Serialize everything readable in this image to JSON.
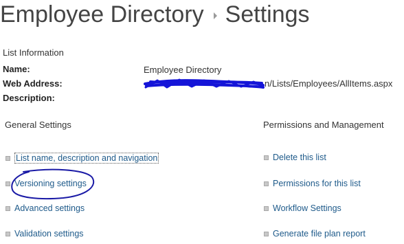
{
  "header": {
    "list_name": "Employee Directory",
    "page_name": "Settings"
  },
  "list_info": {
    "section_title": "List Information",
    "name_label": "Name:",
    "name_value": "Employee Directory",
    "web_address_label": "Web Address:",
    "web_address_suffix": "n/Lists/Employees/AllItems.aspx",
    "description_label": "Description:"
  },
  "general_settings": {
    "title": "General Settings",
    "items": [
      {
        "label": "List name, description and navigation"
      },
      {
        "label": "Versioning settings"
      },
      {
        "label": "Advanced settings"
      },
      {
        "label": "Validation settings"
      }
    ]
  },
  "permissions": {
    "title": "Permissions and Management",
    "items": [
      {
        "label": "Delete this list"
      },
      {
        "label": "Permissions for this list"
      },
      {
        "label": "Workflow Settings"
      },
      {
        "label": "Generate file plan report"
      }
    ]
  },
  "colors": {
    "link": "#1e5a8a",
    "annotation": "#1a1aa6",
    "redaction": "#1515d8"
  }
}
